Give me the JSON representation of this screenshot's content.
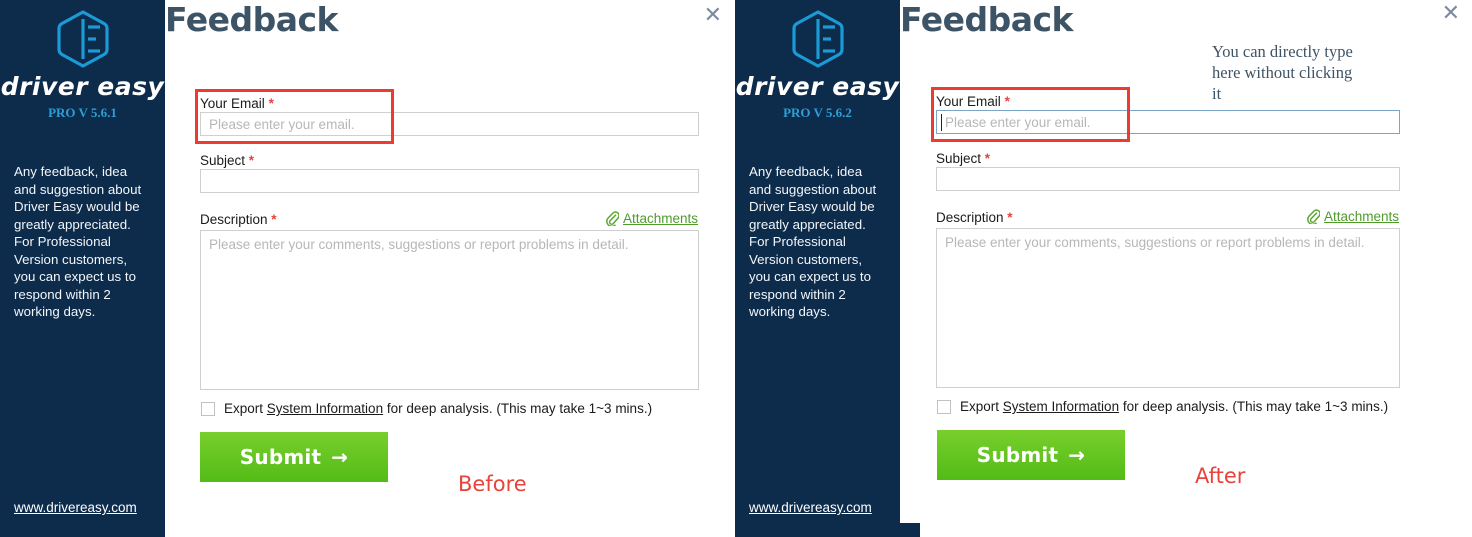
{
  "before": {
    "caption": "Before",
    "sidebar": {
      "brand": "driver easy",
      "version": "PRO V 5.6.1",
      "blurb": "Any feedback, idea and suggestion about Driver Easy would be greatly appreciated. For Professional Version customers, you can expect us to respond within 2 working days.",
      "site_link": "www.drivereasy.com",
      "logo_icon": "driver-easy-hexagon-logo"
    },
    "form": {
      "title": "Feedback",
      "close_icon": "close-icon",
      "email_label": "Your Email",
      "email_required": "*",
      "email_placeholder": "Please enter your email.",
      "email_value": "",
      "subject_label": "Subject",
      "subject_required": "*",
      "subject_placeholder": "",
      "subject_value": "",
      "description_label": "Description",
      "description_required": "*",
      "description_placeholder": "Please enter your comments, suggestions or report problems in detail.",
      "description_value": "",
      "attachments_label": "Attachments",
      "attachments_icon": "paperclip-icon",
      "checkbox_checked": false,
      "checkbox_text_1": "Export ",
      "checkbox_text_link": "System Information",
      "checkbox_text_2": " for deep analysis. (This may take 1~3 mins.)",
      "submit_label": "Submit",
      "submit_arrow": "→"
    }
  },
  "after": {
    "caption": "After",
    "annotation": "You can directly type here without clicking it",
    "sidebar": {
      "brand": "driver easy",
      "version": "PRO V 5.6.2",
      "blurb": "Any feedback, idea and suggestion about Driver Easy would be greatly appreciated. For Professional Version customers, you can expect us to respond within 2 working days.",
      "site_link": "www.drivereasy.com",
      "logo_icon": "driver-easy-hexagon-logo"
    },
    "form": {
      "title": "Feedback",
      "close_icon": "close-icon",
      "email_label": "Your Email",
      "email_required": "*",
      "email_placeholder": "Please enter your email.",
      "email_value": "",
      "email_focused": true,
      "subject_label": "Subject",
      "subject_required": "*",
      "subject_placeholder": "",
      "subject_value": "",
      "description_label": "Description",
      "description_required": "*",
      "description_placeholder": "Please enter your comments, suggestions or report problems in detail.",
      "description_value": "",
      "attachments_label": "Attachments",
      "attachments_icon": "paperclip-icon",
      "checkbox_checked": false,
      "checkbox_text_1": "Export ",
      "checkbox_text_link": "System Information",
      "checkbox_text_2": " for deep analysis. (This may take 1~3 mins.)",
      "submit_label": "Submit",
      "submit_arrow": "→"
    }
  },
  "colors": {
    "sidebar_bg": "#0d2b4b",
    "accent_blue": "#2e9fd6",
    "title_slate": "#3d5366",
    "highlight_red": "#ec3c32",
    "submit_green": "#5bbf1b",
    "attach_green": "#4f9c2d"
  }
}
